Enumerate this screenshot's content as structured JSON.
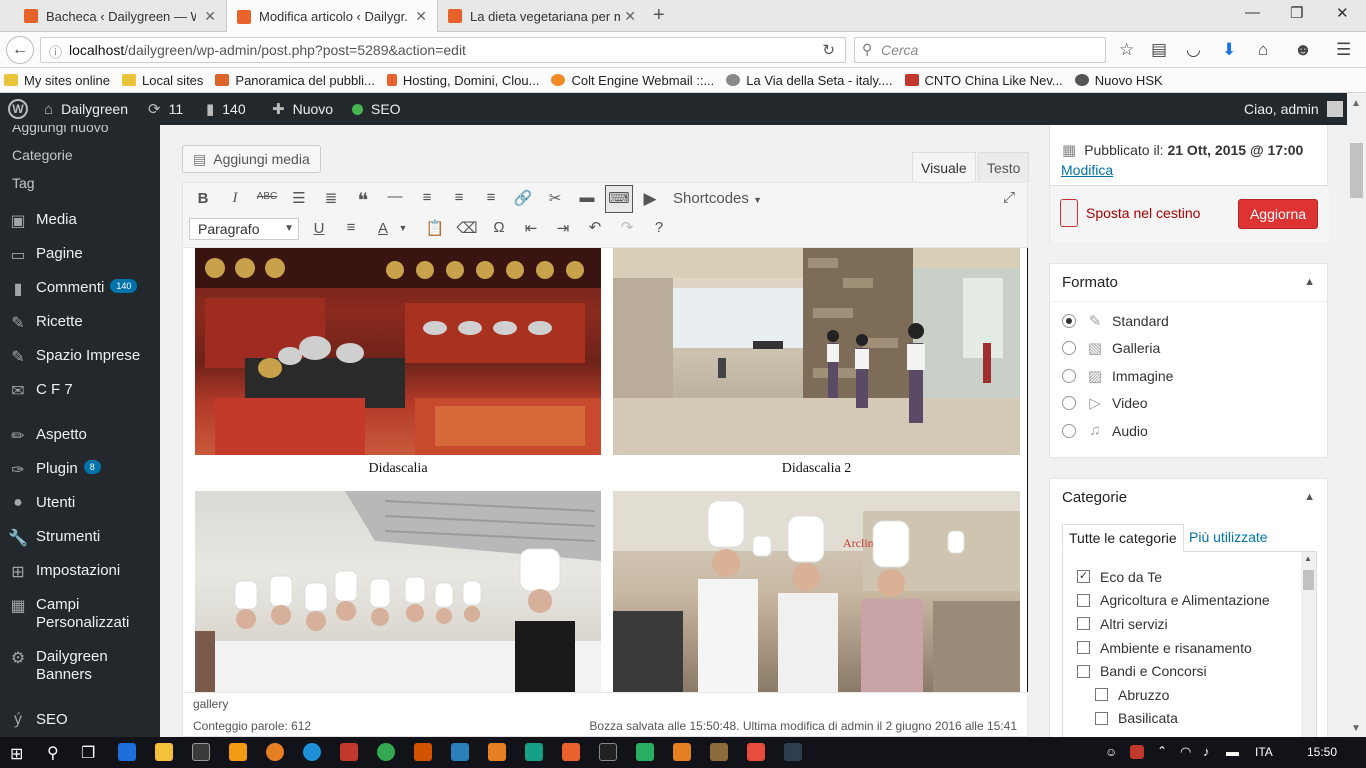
{
  "browser": {
    "tabs": [
      {
        "title": "Bacheca ‹ Dailygreen — W..."
      },
      {
        "title": "Modifica articolo ‹ Dailygr..."
      },
      {
        "title": "La dieta vegetariana per m..."
      }
    ],
    "url_host": "localhost",
    "url_path": "/dailygreen/wp-admin/post.php?post=5289&action=edit",
    "search_placeholder": "Cerca",
    "bookmarks": [
      {
        "label": "My sites online",
        "color": "#e8c33b"
      },
      {
        "label": "Local sites",
        "color": "#e8c33b"
      },
      {
        "label": "Panoramica del pubbli...",
        "color": "#d9652b"
      },
      {
        "label": "Hosting, Domini, Clou...",
        "color": "#e8632b"
      },
      {
        "label": "Colt Engine Webmail ::...",
        "color": "#f08a24"
      },
      {
        "label": "La Via della Seta - italy....",
        "color": "#888888"
      },
      {
        "label": "CNTO China Like Nev...",
        "color": "#c0392b"
      },
      {
        "label": "Nuovo HSK",
        "color": "#555555"
      }
    ]
  },
  "adminbar": {
    "site": "Dailygreen",
    "updates": "11",
    "comments": "140",
    "new": "Nuovo",
    "seo": "SEO",
    "greeting": "Ciao, admin"
  },
  "sidebar": {
    "sub_items": [
      "Aggiungi nuovo",
      "Categorie",
      "Tag"
    ],
    "items": [
      {
        "label": "Media",
        "icon": "media-icon"
      },
      {
        "label": "Pagine",
        "icon": "pages-icon"
      },
      {
        "label": "Commenti",
        "icon": "comments-icon",
        "badge": "140"
      },
      {
        "label": "Ricette",
        "icon": "pin-icon"
      },
      {
        "label": "Spazio Imprese",
        "icon": "pin-icon"
      },
      {
        "label": "C F 7",
        "icon": "mail-icon"
      },
      {
        "label": "Aspetto",
        "icon": "appearance-icon"
      },
      {
        "label": "Plugin",
        "icon": "plugin-icon",
        "badge": "8"
      },
      {
        "label": "Utenti",
        "icon": "users-icon"
      },
      {
        "label": "Strumenti",
        "icon": "tools-icon"
      },
      {
        "label": "Impostazioni",
        "icon": "settings-icon"
      },
      {
        "label": "Campi Personalizzati",
        "icon": "table-icon"
      },
      {
        "label": "Dailygreen Banners",
        "icon": "gear-icon"
      },
      {
        "label": "SEO",
        "icon": "seo-icon"
      }
    ]
  },
  "editor": {
    "add_media": "Aggiungi media",
    "tab_visual": "Visuale",
    "tab_text": "Testo",
    "shortcodes": "Shortcodes",
    "paragraph": "Paragrafo",
    "captions": [
      "Didascalia",
      "Didascalia 2"
    ],
    "path": "gallery",
    "word_count": "Conteggio parole: 612",
    "saved_status": "Bozza salvata alle 15:50:48. Ultima modifica di admin il 2 giugno 2016 alle 15:41"
  },
  "publish": {
    "published_label": "Pubblicato il:",
    "published_date": "21 Ott, 2015 @ 17:00",
    "edit_link": "Modifica",
    "trash": "Sposta nel cestino",
    "update_button": "Aggiorna"
  },
  "format_box": {
    "title": "Formato",
    "options": [
      {
        "label": "Standard",
        "icon": "pin-icon",
        "selected": true
      },
      {
        "label": "Galleria",
        "icon": "gallery-icon",
        "selected": false
      },
      {
        "label": "Immagine",
        "icon": "image-icon",
        "selected": false
      },
      {
        "label": "Video",
        "icon": "video-icon",
        "selected": false
      },
      {
        "label": "Audio",
        "icon": "audio-icon",
        "selected": false
      }
    ]
  },
  "categories_box": {
    "title": "Categorie",
    "tab_all": "Tutte le categorie",
    "tab_popular": "Più utilizzate",
    "items": [
      {
        "label": "Eco da Te",
        "checked": true,
        "child": false
      },
      {
        "label": "Agricoltura e Alimentazione",
        "checked": false,
        "child": false
      },
      {
        "label": "Altri servizi",
        "checked": false,
        "child": false
      },
      {
        "label": "Ambiente e risanamento",
        "checked": false,
        "child": false
      },
      {
        "label": "Bandi e Concorsi",
        "checked": false,
        "child": false
      },
      {
        "label": "Abruzzo",
        "checked": false,
        "child": true
      },
      {
        "label": "Basilicata",
        "checked": false,
        "child": true
      }
    ]
  },
  "taskbar": {
    "lang": "ITA",
    "time": "15:50"
  }
}
